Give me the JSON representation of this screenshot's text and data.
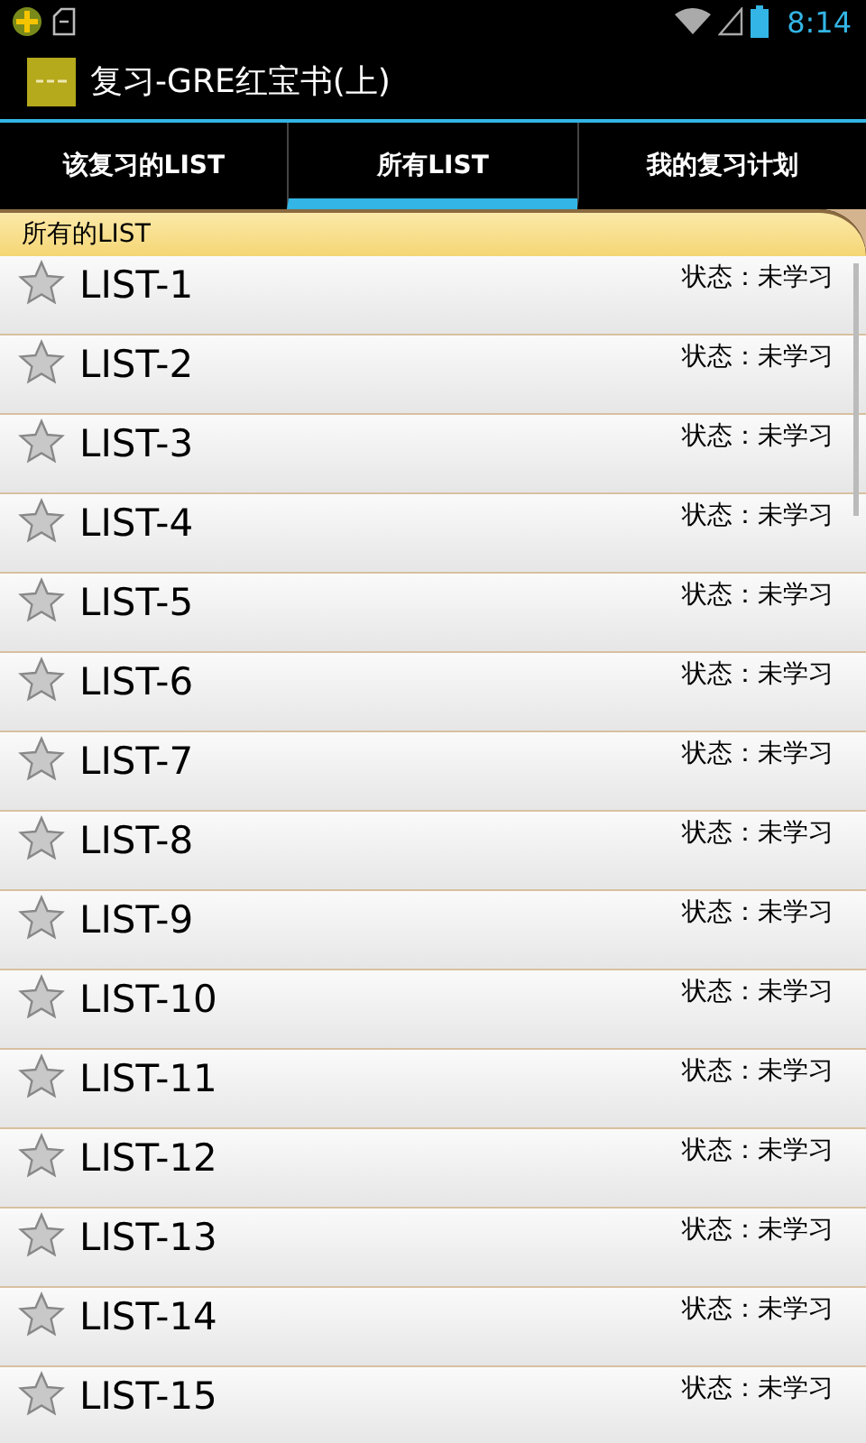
{
  "status_bar": {
    "time": "8:14"
  },
  "app_bar": {
    "title": "复习-GRE红宝书(上)"
  },
  "tabs": [
    {
      "label": "该复习的LIST",
      "selected": false
    },
    {
      "label": "所有LIST",
      "selected": true
    },
    {
      "label": "我的复习计划",
      "selected": false
    }
  ],
  "section": {
    "title": "所有的LIST"
  },
  "lists": [
    {
      "name": "LIST-1",
      "status": "状态：未学习",
      "starred": false
    },
    {
      "name": "LIST-2",
      "status": "状态：未学习",
      "starred": false
    },
    {
      "name": "LIST-3",
      "status": "状态：未学习",
      "starred": false
    },
    {
      "name": "LIST-4",
      "status": "状态：未学习",
      "starred": false
    },
    {
      "name": "LIST-5",
      "status": "状态：未学习",
      "starred": false
    },
    {
      "name": "LIST-6",
      "status": "状态：未学习",
      "starred": false
    },
    {
      "name": "LIST-7",
      "status": "状态：未学习",
      "starred": false
    },
    {
      "name": "LIST-8",
      "status": "状态：未学习",
      "starred": false
    },
    {
      "name": "LIST-9",
      "status": "状态：未学习",
      "starred": false
    },
    {
      "name": "LIST-10",
      "status": "状态：未学习",
      "starred": false
    },
    {
      "name": "LIST-11",
      "status": "状态：未学习",
      "starred": false
    },
    {
      "name": "LIST-12",
      "status": "状态：未学习",
      "starred": false
    },
    {
      "name": "LIST-13",
      "status": "状态：未学习",
      "starred": false
    },
    {
      "name": "LIST-14",
      "status": "状态：未学习",
      "starred": false
    },
    {
      "name": "LIST-15",
      "status": "状态：未学习",
      "starred": false
    }
  ]
}
